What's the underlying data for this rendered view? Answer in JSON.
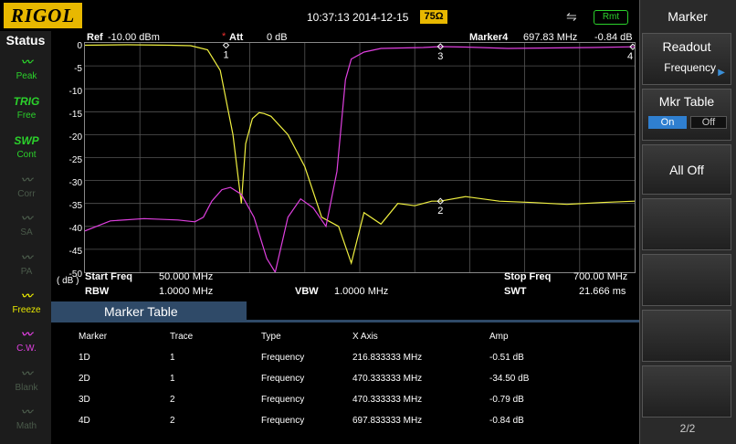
{
  "topbar": {
    "logo": "RIGOL",
    "datetime": "10:37:13 2014-12-15",
    "impedance": "75Ω",
    "usb_icon": "usb-icon",
    "remote": "Rmt"
  },
  "status": {
    "title": "Status",
    "items": [
      {
        "icon": "peak-icon",
        "label": "Peak",
        "color": "#2bd12b"
      },
      {
        "icon": "TRIG",
        "label": "Free",
        "color": "#2bd12b"
      },
      {
        "icon": "SWP",
        "label": "Cont",
        "color": "#2bd12b"
      },
      {
        "icon": "corr-icon",
        "label": "Corr",
        "color": "#4a5a4a"
      },
      {
        "icon": "sa-icon",
        "label": "SA",
        "color": "#4a5a4a"
      },
      {
        "icon": "pa-icon",
        "label": "PA",
        "color": "#4a5a4a"
      },
      {
        "icon": "freeze-icon",
        "label": "Freeze",
        "color": "#e8e800"
      },
      {
        "icon": "cw-icon",
        "label": "C.W.",
        "color": "#e040e0"
      },
      {
        "icon": "blank-icon",
        "label": "Blank",
        "color": "#4a5a4a"
      },
      {
        "icon": "math-icon",
        "label": "Math",
        "color": "#4a5a4a"
      }
    ]
  },
  "display": {
    "ref_label": "Ref",
    "ref_value": "-10.00 dBm",
    "att_label": "Att",
    "att_value": "0 dB",
    "marker_label": "Marker4",
    "marker_freq": "697.83 MHz",
    "marker_amp": "-0.84 dB",
    "unit": "( dB )",
    "start_label": "Start Freq",
    "start_value": "50.000 MHz",
    "stop_label": "Stop Freq",
    "stop_value": "700.00 MHz",
    "rbw_label": "RBW",
    "rbw_value": "1.0000 MHz",
    "vbw_label": "VBW",
    "vbw_value": "1.0000 MHz",
    "swt_label": "SWT",
    "swt_value": "21.666 ms",
    "trace1_color": "#f0f040",
    "trace2_color": "#e040e0"
  },
  "chart_data": {
    "type": "line",
    "ylim": [
      -50,
      0
    ],
    "xlim": [
      50,
      700
    ],
    "yticks": [
      "0",
      "-5",
      "-10",
      "-15",
      "-20",
      "-25",
      "-30",
      "-35",
      "-40",
      "-45",
      "-50"
    ],
    "grid": true,
    "series": [
      {
        "x": [
          50,
          100,
          150,
          175,
          195,
          210,
          225,
          235,
          240,
          248,
          256,
          262,
          270,
          290,
          310,
          330,
          350,
          365,
          380,
          400,
          420,
          440,
          460,
          470,
          500,
          540,
          580,
          620,
          660,
          700
        ],
        "y": [
          -0.5,
          -0.4,
          -0.5,
          -0.6,
          -1.5,
          -6,
          -20,
          -35,
          -22,
          -16.5,
          -15.2,
          -15.4,
          -16,
          -20,
          -27,
          -38,
          -40,
          -48,
          -37,
          -39.5,
          -35,
          -35.5,
          -34.5,
          -34.5,
          -33.5,
          -34.5,
          -34.8,
          -35.2,
          -34.8,
          -34.5
        ]
      },
      {
        "x": [
          50,
          80,
          120,
          160,
          180,
          190,
          200,
          212,
          222,
          235,
          250,
          265,
          275,
          290,
          305,
          320,
          335,
          348,
          358,
          365,
          380,
          400,
          450,
          470,
          500,
          550,
          600,
          650,
          700
        ],
        "y": [
          -41,
          -38.8,
          -38.3,
          -38.6,
          -39,
          -38,
          -34.5,
          -32,
          -31.5,
          -33,
          -38,
          -47,
          -50,
          -38,
          -34,
          -36,
          -40,
          -28,
          -8,
          -3.5,
          -2,
          -1.2,
          -1,
          -0.8,
          -0.9,
          -1.2,
          -1.1,
          -1,
          -0.84
        ]
      }
    ],
    "markers": [
      {
        "label": "1",
        "x": 216.833333,
        "y": -0.51
      },
      {
        "label": "2",
        "x": 470.333333,
        "y": -34.5
      },
      {
        "label": "3",
        "x": 470.333333,
        "y": -0.79
      },
      {
        "label": "4",
        "x": 697.833333,
        "y": -0.84
      }
    ]
  },
  "marker_table": {
    "title": "Marker Table",
    "headers": [
      "Marker",
      "Trace",
      "Type",
      "X Axis",
      "Amp"
    ],
    "rows": [
      [
        "1D",
        "1",
        "Frequency",
        "216.833333 MHz",
        "-0.51 dB"
      ],
      [
        "2D",
        "1",
        "Frequency",
        "470.333333 MHz",
        "-34.50 dB"
      ],
      [
        "3D",
        "2",
        "Frequency",
        "470.333333 MHz",
        "-0.79 dB"
      ],
      [
        "4D",
        "2",
        "Frequency",
        "697.833333 MHz",
        "-0.84 dB"
      ]
    ]
  },
  "menu": {
    "title": "Marker",
    "readout_label": "Readout",
    "readout_value": "Frequency",
    "mkr_table_label": "Mkr Table",
    "on_label": "On",
    "off_label": "Off",
    "all_off_label": "All Off",
    "page": "2/2"
  }
}
